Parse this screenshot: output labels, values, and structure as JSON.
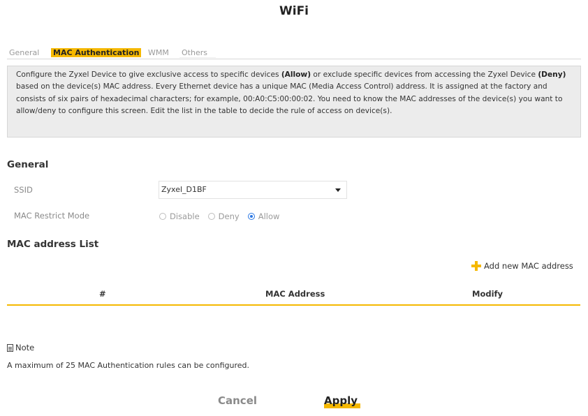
{
  "page": {
    "title": "WiFi"
  },
  "tabs": [
    {
      "label": "General",
      "active": false
    },
    {
      "label": "MAC Authentication",
      "active": true
    },
    {
      "label": "WMM",
      "active": false
    },
    {
      "label": "Others",
      "active": false
    }
  ],
  "intro": {
    "part1": "Configure the Zyxel Device to give exclusive access to specific devices ",
    "allow": "(Allow)",
    "part2": " or exclude specific devices from accessing the Zyxel Device ",
    "deny": "(Deny)",
    "part3": " based on the device(s) MAC address. Every Ethernet device has a unique MAC (Media Access Control) address. It is assigned at the factory and consists of six pairs of hexadecimal characters; for example, 00:A0:C5:00:00:02. You need to know the MAC addresses of the device(s) you want to allow/deny to configure this screen. Edit the list in the table to decide the rule of access on device(s)."
  },
  "general": {
    "title": "General",
    "ssid_label": "SSID",
    "ssid_value": "Zyxel_D1BF",
    "restrict_label": "MAC Restrict Mode",
    "options": [
      "Disable",
      "Deny",
      "Allow"
    ],
    "selected": "Allow"
  },
  "mac_list": {
    "title": "MAC address List",
    "add_label": "Add new MAC address",
    "columns": [
      "#",
      "MAC Address",
      "Modify"
    ],
    "rows": []
  },
  "note": {
    "label": "Note",
    "text": "A maximum of 25 MAC Authentication rules can be configured."
  },
  "buttons": {
    "cancel": "Cancel",
    "apply": "Apply"
  },
  "colors": {
    "accent": "#f5b800",
    "radio_checked": "#2b78e4"
  }
}
